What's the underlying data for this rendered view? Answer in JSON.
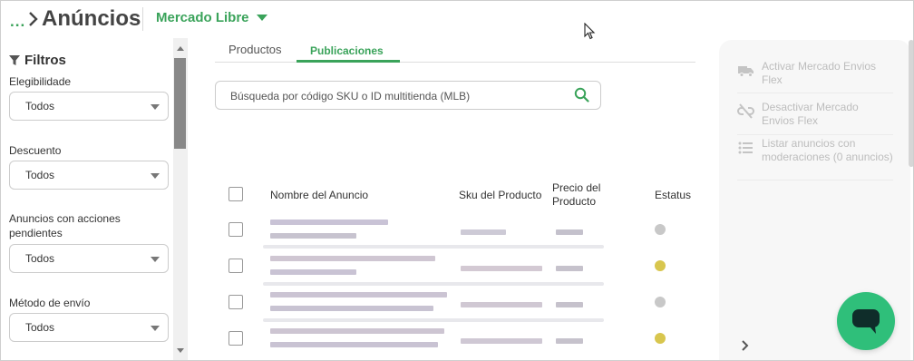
{
  "header": {
    "breadcrumb_dots": "...",
    "title": "Anúncios",
    "store": "Mercado Libre"
  },
  "filters": {
    "title": "Filtros",
    "groups": [
      {
        "label": "Elegibilidade",
        "value": "Todos"
      },
      {
        "label": "Descuento",
        "value": "Todos"
      },
      {
        "label": "Anuncios con acciones pendientes",
        "value": "Todos"
      },
      {
        "label": "Método de envío",
        "value": "Todos"
      }
    ]
  },
  "tabs": [
    {
      "label": "Productos",
      "active": false
    },
    {
      "label": "Publicaciones",
      "active": true
    }
  ],
  "search": {
    "placeholder": "Búsqueda por código SKU o ID multitienda (MLB)"
  },
  "table": {
    "columns": [
      "Nombre del Anuncio",
      "Sku del Producto",
      "Precio del Producto",
      "Estatus"
    ],
    "rows": [
      {
        "status_color": "#c8c8c8"
      },
      {
        "status_color": "#d8c64e"
      },
      {
        "status_color": "#c8c8c8"
      },
      {
        "status_color": "#d8c64e"
      }
    ]
  },
  "actions": [
    {
      "label": "Activar Mercado Envios Flex",
      "icon": "truck-icon"
    },
    {
      "label": "Desactivar Mercado Envios Flex",
      "icon": "unlink-icon"
    },
    {
      "label": "Listar anuncios con moderaciones (0 anuncios)",
      "icon": "list-icon"
    }
  ],
  "colors": {
    "accent": "#3aa35a",
    "chat": "#2fbf7a",
    "status_gray": "#c8c8c8",
    "status_yellow": "#d8c64e"
  }
}
